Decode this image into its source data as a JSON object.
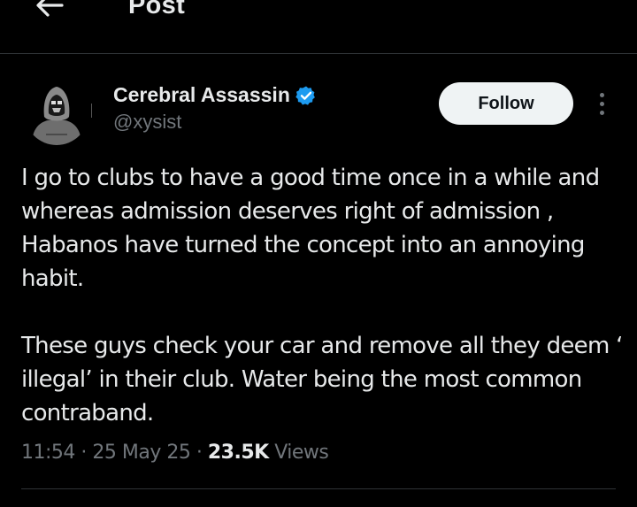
{
  "header": {
    "title": "Post",
    "back_icon": "arrow-left-icon"
  },
  "author": {
    "display_name": "Cerebral Assassin",
    "handle": "@xysist",
    "verified": true,
    "verified_color": "#1d9bf0",
    "avatar_icon": "hooded-figure-avatar"
  },
  "actions": {
    "follow_label": "Follow",
    "more_icon": "more-vertical-icon"
  },
  "post": {
    "paragraphs": [
      "I go to clubs to have a good time once in a while and whereas admission deserves right of admission , Habanos have turned the concept into an annoying habit.",
      "These guys check your car and remove all they deem ‘ illegal’ in their club. Water being the most common contraband."
    ],
    "time": "11:54",
    "date": "25 May 25",
    "separator": "·",
    "views_count": "23.5K",
    "views_label": "Views"
  },
  "colors": {
    "background": "#000000",
    "text_primary": "#e7e9ea",
    "text_secondary": "#71767b",
    "divider": "#2f3336",
    "follow_bg": "#eff3f4"
  }
}
